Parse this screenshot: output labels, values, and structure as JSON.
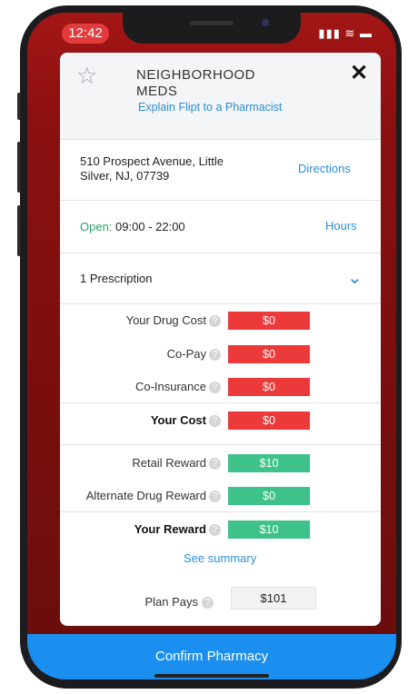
{
  "status_bar": {
    "time": "12:42",
    "icons": "▮▮▮ ≋ ▬"
  },
  "header": {
    "star_icon": "☆",
    "pharmacy_name": "NEIGHBORHOOD\nMEDS",
    "explain_link": "Explain Flipt to a Pharmacist",
    "close_icon": "✕"
  },
  "address": {
    "text": "510 Prospect Avenue, Little\nSilver, NJ, 07739",
    "directions_label": "Directions"
  },
  "hours": {
    "open_label": "Open:",
    "hours_text": "09:00 - 22:00",
    "hours_link": "Hours"
  },
  "prescriptions": {
    "label": "1 Prescription",
    "chevron": "⌄"
  },
  "costs": {
    "drug_cost_label": "Your Drug Cost",
    "drug_cost_value": "$0",
    "copay_label": "Co-Pay",
    "copay_value": "$0",
    "coinsurance_label": "Co-Insurance",
    "coinsurance_value": "$0",
    "your_cost_label": "Your Cost",
    "your_cost_value": "$0"
  },
  "rewards": {
    "retail_label": "Retail Reward",
    "retail_value": "$10",
    "alternate_label": "Alternate Drug Reward",
    "alternate_value": "$0",
    "your_reward_label": "Your Reward",
    "your_reward_value": "$10"
  },
  "summary_link": "See summary",
  "plan": {
    "label": "Plan Pays",
    "value": "$101"
  },
  "info_icon": "?",
  "confirm_button": "Confirm Pharmacy",
  "colors": {
    "cost_red": "#ec3a3a",
    "reward_green": "#3ec28a",
    "link_blue": "#2a8fd6",
    "confirm_blue": "#1a8ff0"
  }
}
